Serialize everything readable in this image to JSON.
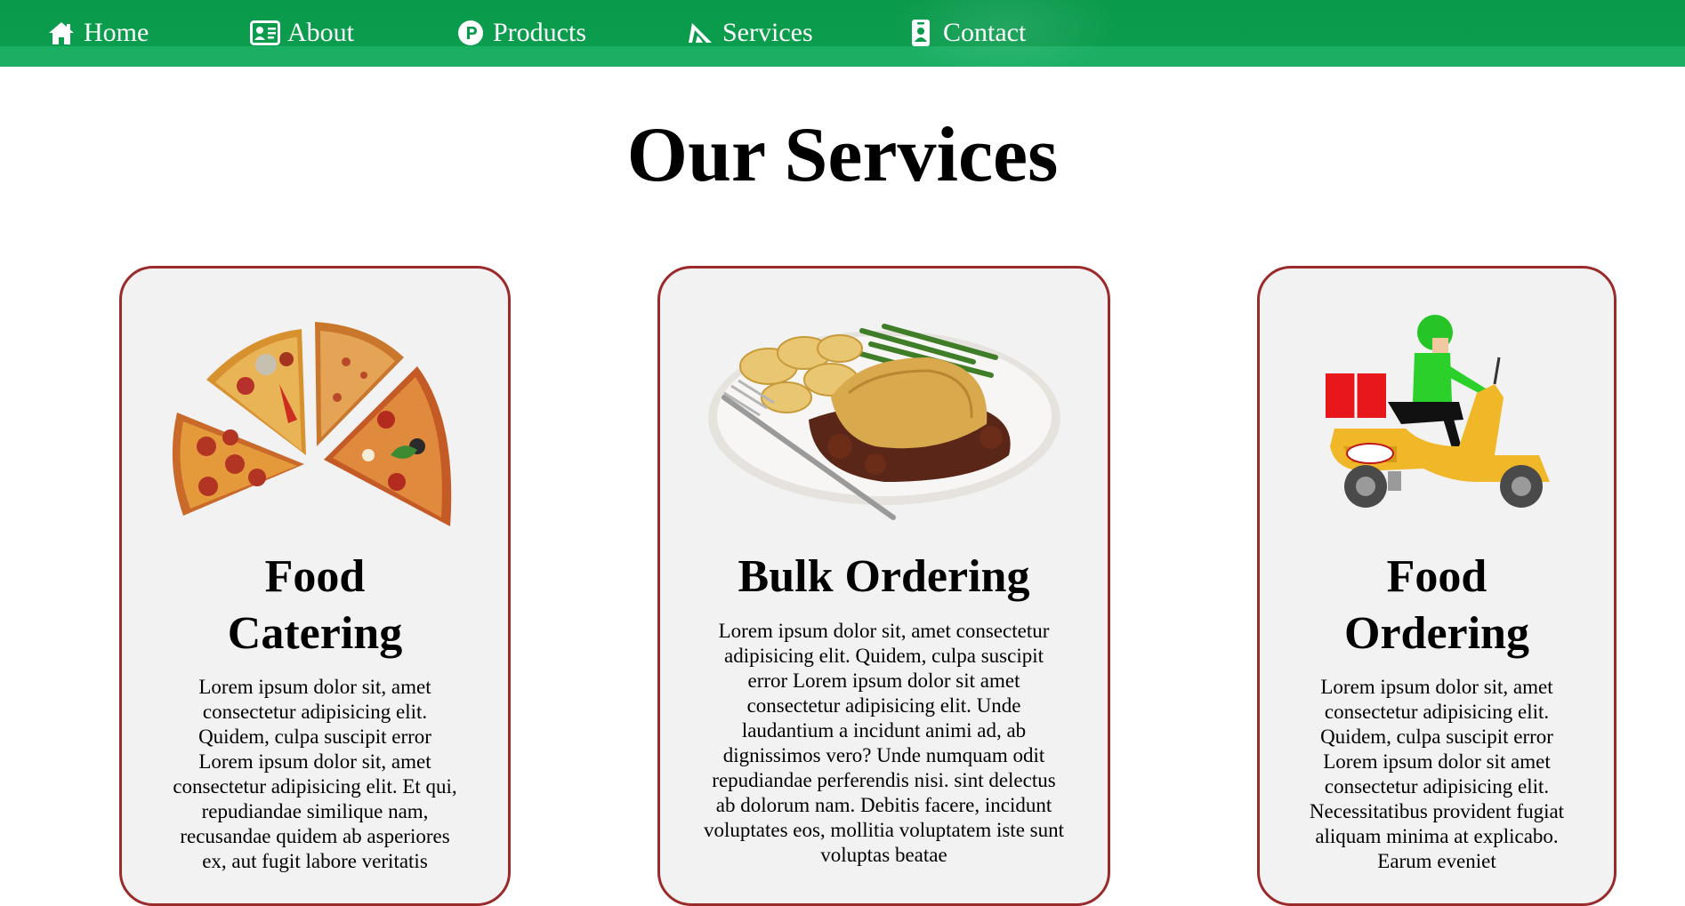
{
  "nav": {
    "items": [
      {
        "label": "Home",
        "icon": "home-icon"
      },
      {
        "label": "About",
        "icon": "id-card-icon"
      },
      {
        "label": "Products",
        "icon": "p-circle-icon"
      },
      {
        "label": "Services",
        "icon": "services-icon"
      },
      {
        "label": "Contact",
        "icon": "contact-badge-icon"
      }
    ],
    "colors": {
      "bar": "#0a9a4c",
      "band": "#1aaf63",
      "text": "#ffffff"
    }
  },
  "page": {
    "title": "Our Services"
  },
  "cards": [
    {
      "image": "pizza-slices-image",
      "title": "Food Catering",
      "text": "Lorem ipsum dolor sit, amet consectetur adipisicing elit. Quidem, culpa suscipit error Lorem ipsum dolor sit, amet consectetur adipisicing elit. Et qui, repudiandae similique nam, recusandae quidem ab asperiores ex, aut fugit labore veritatis"
    },
    {
      "image": "meal-plate-image",
      "title": "Bulk Ordering",
      "text": "Lorem ipsum dolor sit, amet consectetur adipisicing elit. Quidem, culpa suscipit error Lorem ipsum dolor sit amet consectetur adipisicing elit. Unde laudantium a incidunt animi ad, ab dignissimos vero? Unde numquam odit repudiandae perferendis nisi. sint delectus ab dolorum nam. Debitis facere, incidunt voluptates eos, mollitia voluptatem iste sunt voluptas beatae"
    },
    {
      "image": "delivery-scooter-image",
      "title": "Food Ordering",
      "text": "Lorem ipsum dolor sit, amet consectetur adipisicing elit. Quidem, culpa suscipit error Lorem ipsum dolor sit amet consectetur adipisicing elit. Necessitatibus provident fugiat aliquam minima at explicabo. Earum eveniet"
    }
  ],
  "colors": {
    "card_bg": "#f2f2f2",
    "card_border": "#9b2a2a"
  }
}
